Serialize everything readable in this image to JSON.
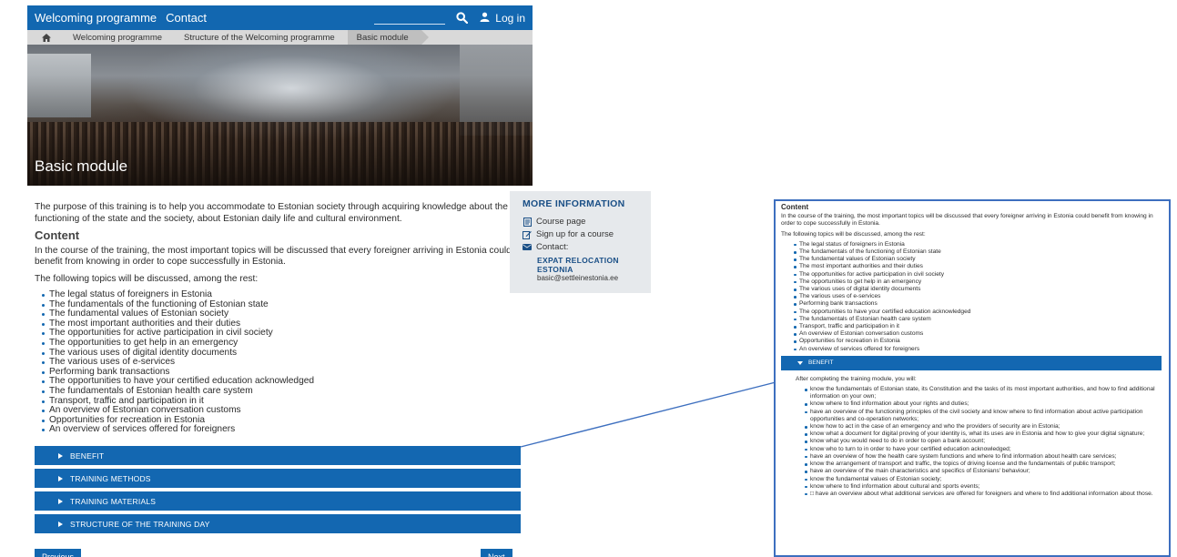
{
  "nav": {
    "links": [
      "Welcoming programme",
      "Contact"
    ],
    "login_label": "Log in",
    "search_placeholder": ""
  },
  "breadcrumb": [
    "Welcoming programme",
    "Structure of the Welcoming programme",
    "Basic module"
  ],
  "hero": {
    "title": "Basic module"
  },
  "main": {
    "intro": "The purpose of this training is to help you accommodate to Estonian society through acquiring knowledge about the functioning of the state and the society, about Estonian daily life and cultural environment.",
    "content_heading": "Content",
    "content_p1": "In the course of the training, the most important topics will be discussed that every foreigner arriving in Estonia could benefit from knowing in order to cope successfully in Estonia.",
    "content_p2": "The following topics will be discussed, among the rest:",
    "topics": [
      "The legal status of foreigners in Estonia",
      "The fundamentals of the functioning of Estonian state",
      "The fundamental values of Estonian society",
      "The most important authorities and their duties",
      "The opportunities for active participation in civil society",
      "The opportunities to get help in an emergency",
      "The various uses of digital identity documents",
      "The various uses of e-services",
      "Performing bank transactions",
      "The opportunities to have your certified education acknowledged",
      "The fundamentals of Estonian health care system",
      "Transport, traffic and participation in it",
      "An overview of Estonian conversation customs",
      "Opportunities for recreation in Estonia",
      "An overview of services offered for foreigners"
    ]
  },
  "info": {
    "title": "MORE INFORMATION",
    "course_page": "Course page",
    "signup": "Sign up for a course",
    "contact": "Contact:",
    "org": "EXPAT RELOCATION ESTONIA",
    "email": "basic@settleinestonia.ee"
  },
  "accordions": [
    "BENEFIT",
    "TRAINING METHODS",
    "TRAINING MATERIALS",
    "STRUCTURE OF THE TRAINING DAY"
  ],
  "pager": {
    "prev": "Previous",
    "next": "Next"
  },
  "zoom": {
    "heading": "Content",
    "p1": "In the course of the training, the most important topics will be discussed that every foreigner arriving in Estonia could benefit from knowing in order to cope successfully in Estonia.",
    "p2": "The following topics will be discussed, among the rest:",
    "topics": [
      "The legal status of foreigners in Estonia",
      "The fundamentals of the functioning of Estonian state",
      "The fundamental values of Estonian society",
      "The most important authorities and their duties",
      "The opportunities for active participation in civil society",
      "The opportunities to get help in an emergency",
      "The various uses of digital identity documents",
      "The various uses of e-services",
      "Performing bank transactions",
      "The opportunities to have your certified education acknowledged",
      "The fundamentals of Estonian health care system",
      "Transport, traffic and participation in it",
      "An overview of Estonian conversation customs",
      "Opportunities for recreation in Estonia",
      "An overview of services offered for foreigners"
    ],
    "accordion_label": "BENEFIT",
    "benefit_intro": "After completing the training module, you will:",
    "benefits": [
      "know the fundamentals of Estonian state, its Constitution and the tasks of its most important authorities, and how to find additional information on your own;",
      "know where to find information about your rights and duties;",
      "have an overview of the functioning principles of the civil society and know where to find information about active participation opportunities and co-operation networks;",
      "know how to act in the case of an emergency and who the providers of security are in Estonia;",
      "know what a document for digital proving of your identity is, what its uses are in Estonia and how to give your digital signature;",
      "know what you would need to do in order to open a bank account;",
      "know who to turn to in order to have your certified education acknowledged;",
      "have an overview of how the health care system functions and where to find information about health care services;",
      "know the arrangement of transport and traffic, the topics of driving license and the fundamentals of public transport;",
      "have an overview of the main characteristics and specifics of Estonians' behaviour;",
      "know the fundamental values of Estonian society;",
      "know where to find information about cultural and sports events;",
      "□ have an overview about what additional services are offered for foreigners and where to find additional information about those."
    ]
  },
  "colors": {
    "brand": "#1267b0",
    "accordion": "#1367b1",
    "info_bg": "#e6e9ec",
    "zoom_border": "#3d6fbf"
  }
}
